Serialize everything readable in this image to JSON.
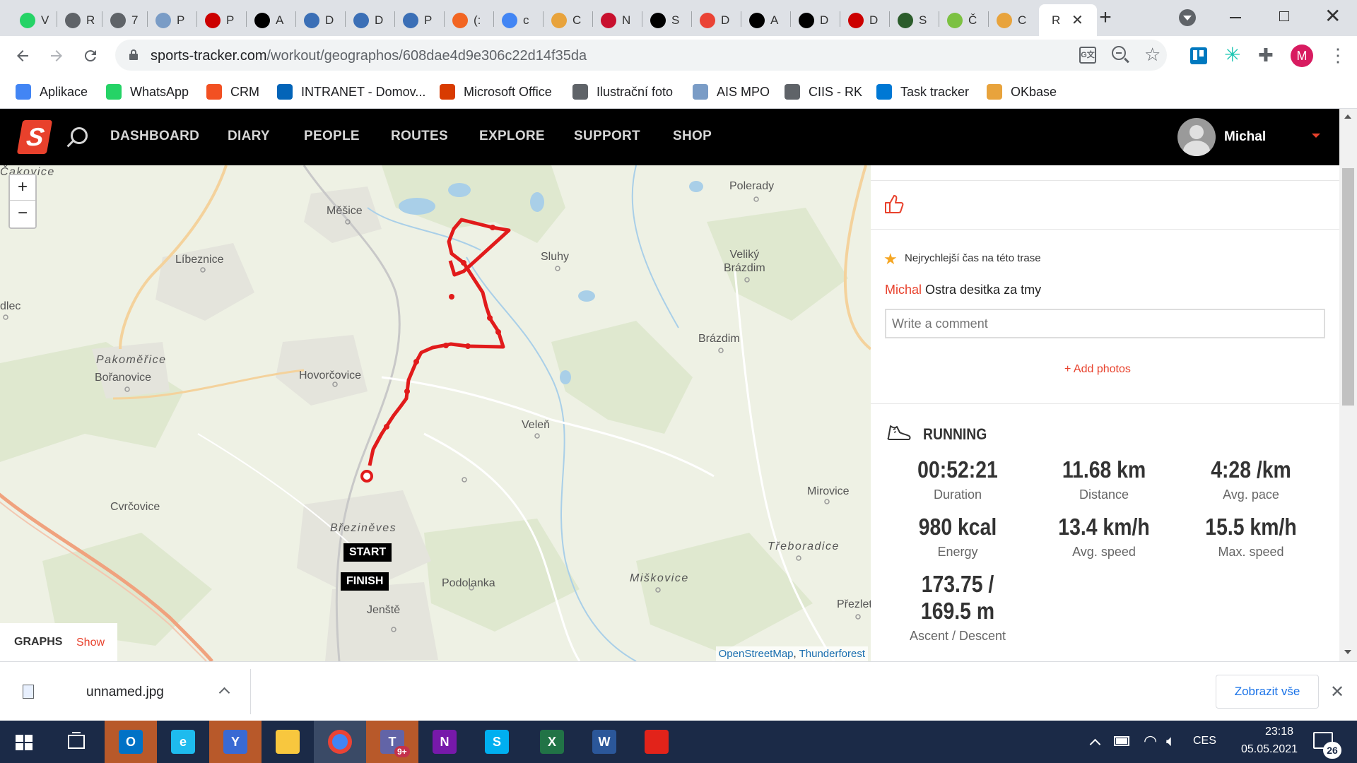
{
  "browser": {
    "tabs": [
      {
        "icon": "whatsapp-icon",
        "label": "V",
        "color": "#25d366"
      },
      {
        "icon": "globe-icon",
        "label": "R",
        "color": "#5f6368"
      },
      {
        "icon": "globe-icon",
        "label": "7",
        "color": "#5f6368"
      },
      {
        "icon": "ais-icon",
        "label": "P",
        "color": "#7a9cc6"
      },
      {
        "icon": "italic-i-icon",
        "label": "P",
        "color": "#c00"
      },
      {
        "icon": "sz-icon",
        "label": "A",
        "color": "#000"
      },
      {
        "icon": "circle-logo-icon",
        "label": "D",
        "color": "#3b6fb6"
      },
      {
        "icon": "circle-logo-icon",
        "label": "D",
        "color": "#3b6fb6"
      },
      {
        "icon": "circle-logo-icon",
        "label": "P",
        "color": "#3b6fb6"
      },
      {
        "icon": "arrow-logo-icon",
        "label": "(:",
        "color": "#f26522"
      },
      {
        "icon": "google-icon",
        "label": "c",
        "color": "#4285f4"
      },
      {
        "icon": "okbase-icon",
        "label": "C",
        "color": "#e8a33c"
      },
      {
        "icon": "in-logo-icon",
        "label": "N",
        "color": "#c8102e"
      },
      {
        "icon": "sz-icon",
        "label": "S",
        "color": "#000"
      },
      {
        "icon": "gmail-icon",
        "label": "D",
        "color": "#ea4335"
      },
      {
        "icon": "r-logo-icon",
        "label": "A",
        "color": "#000"
      },
      {
        "icon": "r-logo-icon",
        "label": "D",
        "color": "#000"
      },
      {
        "icon": "italic-i-icon",
        "label": "D",
        "color": "#c00"
      },
      {
        "icon": "globe-dark-icon",
        "label": "S",
        "color": "#2b5c2b"
      },
      {
        "icon": "m-logo-icon",
        "label": "Č",
        "color": "#7cc142"
      },
      {
        "icon": "okbase-icon",
        "label": "C",
        "color": "#e8a33c"
      },
      {
        "icon": "none",
        "label": "R",
        "color": "#fff"
      }
    ],
    "active_tab_label": "R",
    "url_domain": "sports-tracker.com",
    "url_path": "/workout/geographos/608dae4d9e306c22d14f35da",
    "profile_initial": "M",
    "bookmarks": [
      {
        "label": "Aplikace",
        "icon": "apps-grid-icon",
        "color": "#4285f4"
      },
      {
        "label": "WhatsApp",
        "icon": "whatsapp-icon",
        "color": "#25d366"
      },
      {
        "label": "CRM",
        "icon": "windows-logo-icon",
        "color": "#f25022"
      },
      {
        "label": "INTRANET - Domov...",
        "icon": "sharepoint-icon",
        "color": "#0364b8"
      },
      {
        "label": "Microsoft Office",
        "icon": "office-icon",
        "color": "#d83b01"
      },
      {
        "label": "Ilustrační foto",
        "icon": "globe-icon",
        "color": "#5f6368"
      },
      {
        "label": "AIS MPO",
        "icon": "ais-icon",
        "color": "#7a9cc6"
      },
      {
        "label": "CIIS - RK",
        "icon": "globe-icon",
        "color": "#5f6368"
      },
      {
        "label": "Task tracker",
        "icon": "task-tracker-icon",
        "color": "#0078d4"
      },
      {
        "label": "OKbase",
        "icon": "okbase-icon",
        "color": "#e8a33c"
      }
    ]
  },
  "site": {
    "nav": [
      "DASHBOARD",
      "DIARY",
      "PEOPLE",
      "ROUTES",
      "EXPLORE",
      "SUPPORT",
      "SHOP"
    ],
    "user_name": "Michal",
    "accent": "#e8412c"
  },
  "map": {
    "zoom_in": "+",
    "zoom_out": "−",
    "places": [
      {
        "name": "Měšice",
        "style": "normal"
      },
      {
        "name": "Polerady",
        "style": "normal"
      },
      {
        "name": "Líbeznice",
        "style": "normal"
      },
      {
        "name": "Sluhy",
        "style": "normal"
      },
      {
        "name": "Veliký\nBrázdim",
        "style": "normal"
      },
      {
        "name": "dlec",
        "style": "normal"
      },
      {
        "name": "Pakoměřice",
        "style": "italic"
      },
      {
        "name": "Bořanovice",
        "style": "normal"
      },
      {
        "name": "Hovorčovice",
        "style": "normal"
      },
      {
        "name": "Brázdim",
        "style": "normal"
      },
      {
        "name": "Veleň",
        "style": "normal"
      },
      {
        "name": "Mirovice",
        "style": "normal"
      },
      {
        "name": "Cvrčovice",
        "style": "normal"
      },
      {
        "name": "Březiněves",
        "style": "italic"
      },
      {
        "name": "Třeboradice",
        "style": "italic"
      },
      {
        "name": "Podolanka",
        "style": "normal"
      },
      {
        "name": "Miškovice",
        "style": "italic"
      },
      {
        "name": "Přezletice",
        "style": "normal"
      },
      {
        "name": "Jenště",
        "style": "normal"
      },
      {
        "name": "Čakovice",
        "style": "italic"
      }
    ],
    "start_label": "START",
    "finish_label": "FINISH",
    "attribution_1": "OpenStreetMap",
    "attribution_sep": ", ",
    "attribution_2": "Thunderforest",
    "graphs_label": "GRAPHS",
    "graphs_toggle": "Show"
  },
  "workout": {
    "record_text": "Nejrychlejší čas na této trase",
    "comment_author": "Michal",
    "comment_text": "Ostra desitka za tmy",
    "comment_placeholder": "Write a comment",
    "add_photos": "+ Add photos",
    "activity": "RUNNING",
    "stats": [
      {
        "value": "00:52:21",
        "label": "Duration"
      },
      {
        "value": "11.68 km",
        "label": "Distance"
      },
      {
        "value": "4:28 /km",
        "label": "Avg. pace"
      },
      {
        "value": "980 kcal",
        "label": "Energy"
      },
      {
        "value": "13.4 km/h",
        "label": "Avg. speed"
      },
      {
        "value": "15.5 km/h",
        "label": "Max. speed"
      }
    ],
    "ascent": "173.75 /",
    "descent": "169.5 m",
    "ascent_label": "Ascent / Descent"
  },
  "downloads": {
    "file_name": "unnamed.jpg",
    "show_all": "Zobrazit vše"
  },
  "taskbar": {
    "apps": [
      {
        "icon": "outlook-icon",
        "color": "#0072c6",
        "letter": "O"
      },
      {
        "icon": "internet-explorer-icon",
        "color": "#1ebbee",
        "letter": "e"
      },
      {
        "icon": "yammer-icon",
        "color": "#396ad3",
        "letter": "Y"
      },
      {
        "icon": "file-explorer-icon",
        "color": "#f8c73e",
        "letter": ""
      },
      {
        "icon": "chrome-icon",
        "color": "#4285f4",
        "letter": ""
      },
      {
        "icon": "teams-icon",
        "color": "#6264a7",
        "letter": "T"
      },
      {
        "icon": "onenote-icon",
        "color": "#7719aa",
        "letter": "N"
      },
      {
        "icon": "skype-icon",
        "color": "#00aff0",
        "letter": "S"
      },
      {
        "icon": "excel-icon",
        "color": "#217346",
        "letter": "X"
      },
      {
        "icon": "word-icon",
        "color": "#2b579a",
        "letter": "W"
      },
      {
        "icon": "pdf-icon",
        "color": "#e2231a",
        "letter": ""
      }
    ],
    "teams_badge": "9+",
    "language": "CES",
    "time": "23:18",
    "date": "05.05.2021",
    "notifications": "26"
  }
}
